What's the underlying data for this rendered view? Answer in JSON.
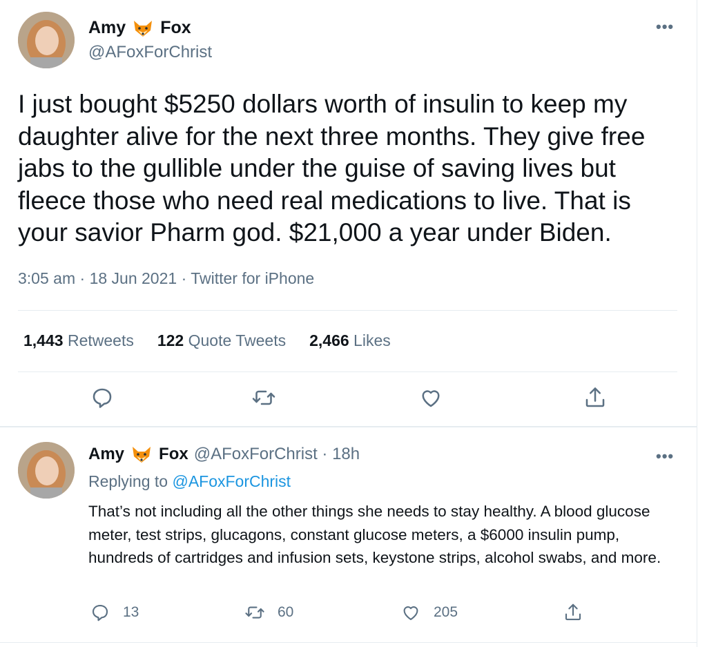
{
  "main_tweet": {
    "author_name_first": "Amy",
    "author_name_last": "Fox",
    "author_emoji": "fox-face-icon",
    "handle": "@AFoxForChrist",
    "text": "I just bought $5250 dollars worth of insulin to keep my daughter alive for the next three months. They give free jabs to the gullible under the guise of saving lives but fleece those who need real medications to live. That is your savior Pharm god. $21,000 a year under Biden.",
    "time": "3:05 am",
    "date": "18 Jun 2021",
    "source": "Twitter for iPhone",
    "stats": {
      "retweets_count": "1,443",
      "retweets_label": "Retweets",
      "quotes_count": "122",
      "quotes_label": "Quote Tweets",
      "likes_count": "2,466",
      "likes_label": "Likes"
    }
  },
  "reply_tweet": {
    "author_name_first": "Amy",
    "author_name_last": "Fox",
    "handle_time": "@AFoxForChrist · 18h",
    "replying_prefix": "Replying to",
    "replying_handle": "@AFoxForChrist",
    "text": "That’s not including all the other things she needs to stay healthy. A blood glucose meter, test strips, glucagons, constant glucose meters, a $6000 insulin pump, hundreds of cartridges and infusion sets, keystone strips, alcohol swabs, and more.",
    "reply_count": "13",
    "retweet_count": "60",
    "like_count": "205"
  },
  "colors": {
    "text_primary": "#0f1419",
    "text_secondary": "#5b7083",
    "link": "#1b95e0",
    "divider": "#e6ecf0"
  },
  "icons": [
    "more-icon",
    "reply-icon",
    "retweet-icon",
    "like-icon",
    "share-icon",
    "fox-face-icon"
  ]
}
